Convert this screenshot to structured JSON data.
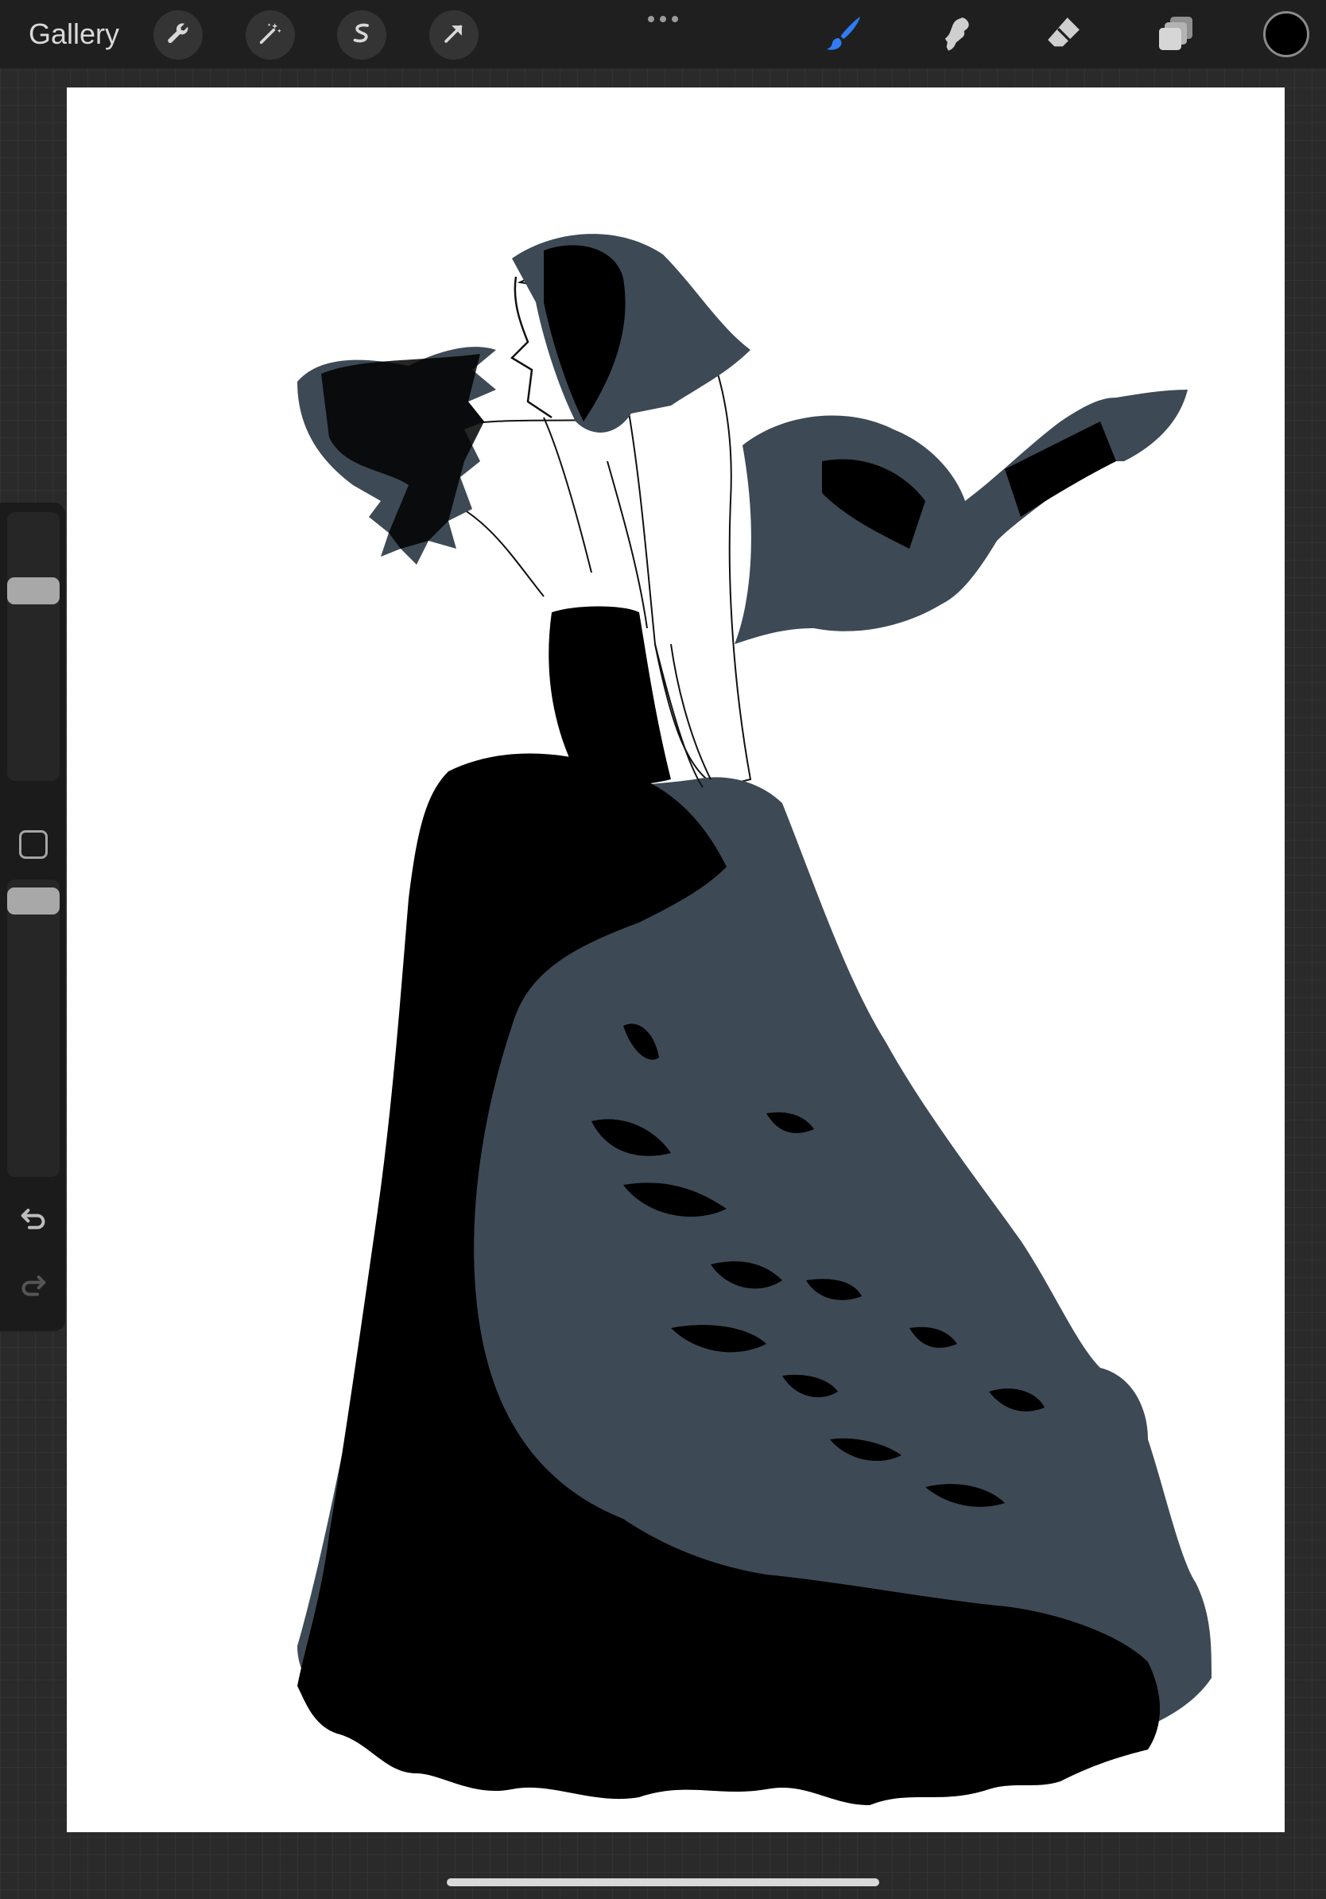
{
  "topbar": {
    "gallery_label": "Gallery",
    "left_tools": [
      {
        "icon": "wrench-icon",
        "name": "actions"
      },
      {
        "icon": "magic-wand-icon",
        "name": "adjustments"
      },
      {
        "icon": "selection-icon",
        "name": "selection"
      },
      {
        "icon": "transform-arrow-icon",
        "name": "transform"
      }
    ],
    "right_tools": [
      {
        "icon": "brush-icon",
        "name": "paint",
        "active": true,
        "color": "#2f7cf6"
      },
      {
        "icon": "smudge-icon",
        "name": "smudge",
        "active": false
      },
      {
        "icon": "eraser-icon",
        "name": "eraser",
        "active": false
      },
      {
        "icon": "layers-icon",
        "name": "layers",
        "active": false
      }
    ],
    "current_color": "#000000"
  },
  "sidebar": {
    "brush_size_level": 0.73,
    "opacity_level": 0.97
  },
  "canvas": {
    "background": "#ffffff",
    "ink_color": "#000000",
    "tone_color": "#3d4a55"
  }
}
